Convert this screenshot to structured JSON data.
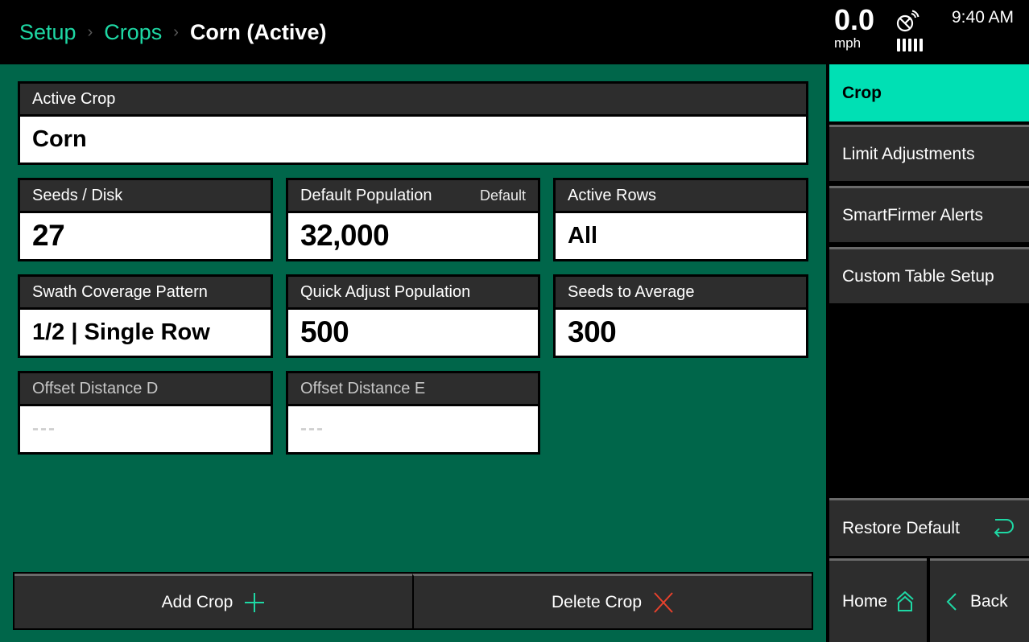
{
  "header": {
    "breadcrumb": [
      {
        "label": "Setup"
      },
      {
        "label": "Crops"
      }
    ],
    "current": "Corn (Active)",
    "separator": "›",
    "speed": {
      "value": "0.0",
      "unit": "mph"
    },
    "gps_signal_bars": 5,
    "time": "9:40 AM"
  },
  "fields": {
    "active_crop": {
      "label": "Active Crop",
      "value": "Corn"
    },
    "seeds_disk": {
      "label": "Seeds / Disk",
      "value": "27"
    },
    "default_population": {
      "label": "Default Population",
      "aux": "Default",
      "value": "32,000"
    },
    "active_rows": {
      "label": "Active Rows",
      "value": "All"
    },
    "swath_coverage": {
      "label": "Swath Coverage Pattern",
      "value": "1/2 | Single Row"
    },
    "quick_adjust": {
      "label": "Quick Adjust Population",
      "value": "500"
    },
    "seeds_to_average": {
      "label": "Seeds to Average",
      "value": "300"
    },
    "offset_d": {
      "label": "Offset Distance D",
      "value": "---"
    },
    "offset_e": {
      "label": "Offset Distance E",
      "value": "---"
    }
  },
  "actions": {
    "add_crop": "Add Crop",
    "delete_crop": "Delete Crop"
  },
  "sidebar": {
    "items": [
      {
        "label": "Crop",
        "active": true
      },
      {
        "label": "Limit Adjustments"
      },
      {
        "label": "SmartFirmer Alerts"
      },
      {
        "label": "Custom Table Setup"
      }
    ],
    "restore_default": "Restore Default",
    "home": "Home",
    "back": "Back"
  },
  "colors": {
    "accent": "#00e0b4",
    "breadcrumb_link": "#1ed8a4",
    "background": "#00664a",
    "panel": "#2d2d2d",
    "delete": "#e8412c"
  }
}
